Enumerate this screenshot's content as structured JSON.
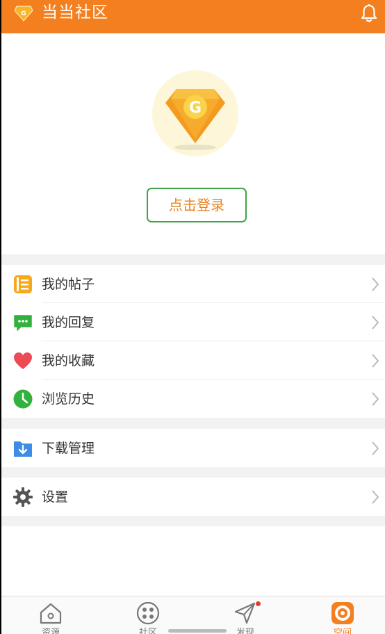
{
  "header": {
    "title": "当当社区",
    "logo_letter": "G"
  },
  "profile": {
    "avatar_letter": "G",
    "login_label": "点击登录"
  },
  "menu_groups": [
    {
      "items": [
        {
          "label": "我的帖子",
          "icon": "document-icon",
          "color": "#f8a91a"
        },
        {
          "label": "我的回复",
          "icon": "chat-bubble-icon",
          "color": "#33b13f"
        },
        {
          "label": "我的收藏",
          "icon": "heart-icon",
          "color": "#ec4b55"
        },
        {
          "label": "浏览历史",
          "icon": "clock-icon",
          "color": "#33b13f"
        }
      ]
    },
    {
      "items": [
        {
          "label": "下载管理",
          "icon": "download-folder-icon",
          "color": "#3d8ce6"
        }
      ]
    },
    {
      "items": [
        {
          "label": "设置",
          "icon": "gear-icon",
          "color": "#555555"
        }
      ]
    }
  ],
  "tabbar": {
    "tabs": [
      {
        "label": "资源",
        "icon": "home-icon",
        "active": false
      },
      {
        "label": "社区",
        "icon": "community-icon",
        "active": false
      },
      {
        "label": "发现",
        "icon": "discover-icon",
        "active": false,
        "badge_dot": true
      },
      {
        "label": "空间",
        "icon": "space-icon",
        "active": true
      }
    ]
  },
  "colors": {
    "brand": "#f47f1f",
    "login_border": "#3fa447",
    "login_text": "#e8821e"
  }
}
